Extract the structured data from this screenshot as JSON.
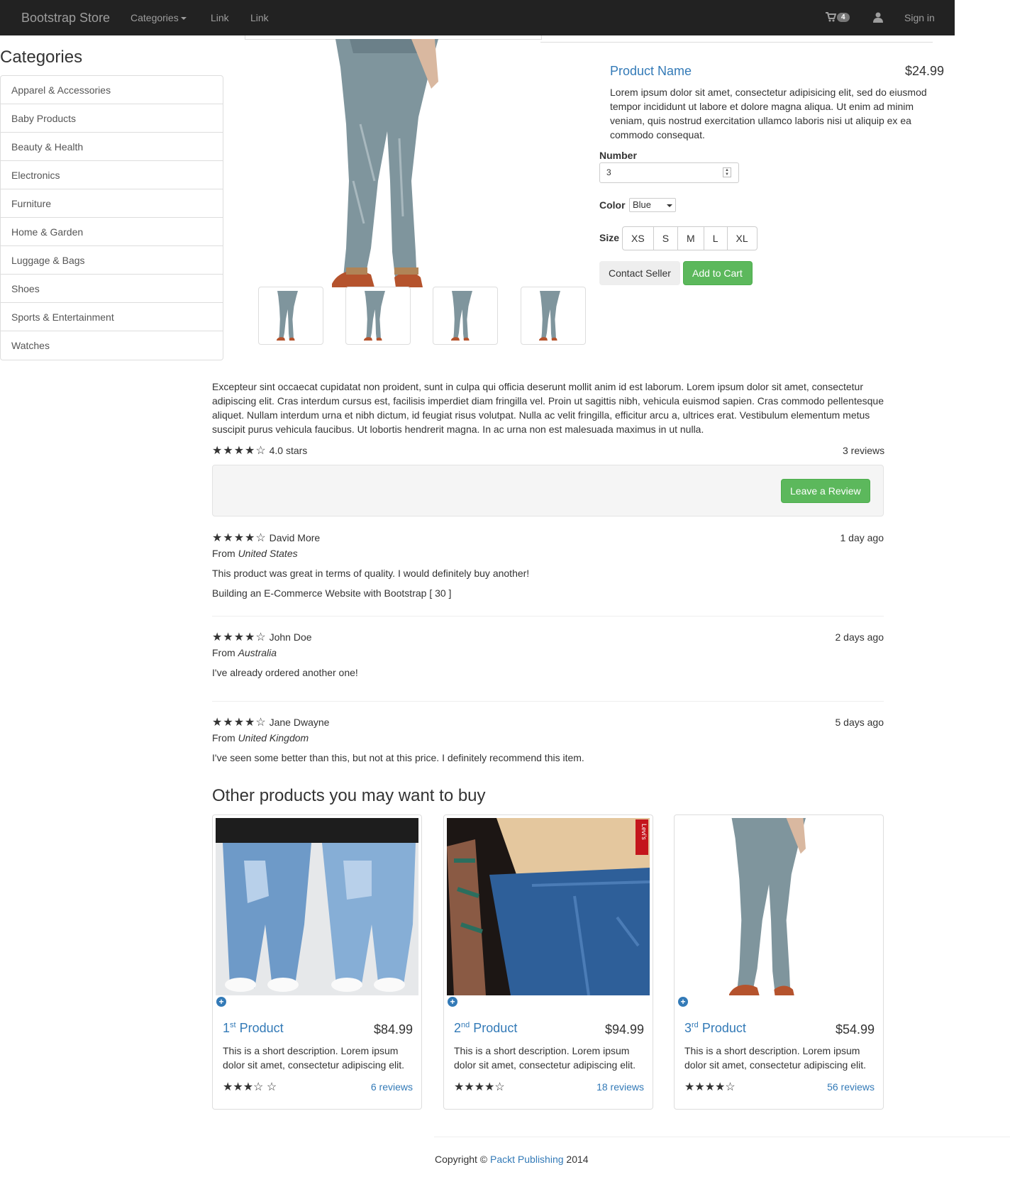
{
  "navbar": {
    "brand": "Bootstrap Store",
    "links": [
      "Categories",
      "Link",
      "Link"
    ],
    "cart_count": "4",
    "sign_in": "Sign in"
  },
  "sidebar": {
    "title": "Categories",
    "items": [
      "Apparel & Accessories",
      "Baby Products",
      "Beauty & Health",
      "Electronics",
      "Furniture",
      "Home & Garden",
      "Luggage & Bags",
      "Shoes",
      "Sports & Entertainment",
      "Watches"
    ]
  },
  "product": {
    "name": "Product Name",
    "price": "$24.99",
    "description": "Lorem ipsum dolor sit amet, consectetur adipisicing elit, sed do eiusmod tempor incididunt ut labore et dolore magna aliqua. Ut enim ad minim veniam, quis nostrud exercitation ullamco laboris nisi ut aliquip ex ea commodo consequat.",
    "number_label": "Number",
    "number_value": "3",
    "color_label": "Color",
    "color_value": "Blue",
    "size_label": "Size",
    "sizes": [
      "XS",
      "S",
      "M",
      "L",
      "XL"
    ],
    "contact_button": "Contact Seller",
    "add_button": "Add to Cart"
  },
  "details": {
    "long_description": "Excepteur sint occaecat cupidatat non proident, sunt in culpa qui officia deserunt mollit anim id est laborum. Lorem ipsum dolor sit amet, consectetur adipiscing elit. Cras interdum cursus est, facilisis imperdiet diam fringilla vel. Proin ut sagittis nibh, vehicula euismod sapien. Cras commodo pellentesque aliquet. Nullam interdum urna et nibh dictum, id feugiat risus volutpat. Nulla ac velit fringilla, efficitur arcu a, ultrices erat. Vestibulum elementum metus suscipit purus vehicula faucibus. Ut lobortis hendrerit magna. In ac urna non est malesuada maximus in ut nulla.",
    "stars": "★★★★☆",
    "rating_text": "4.0 stars",
    "review_count": "3 reviews",
    "leave_review": "Leave a Review"
  },
  "reviews": [
    {
      "stars": "★★★★☆",
      "name": "David More",
      "when": "1 day ago",
      "from_label": "From",
      "country": "United States",
      "text": "This product was great in terms of quality. I would definitely buy another!",
      "extra": "Building an E-Commerce Website with Bootstrap [ 30 ]"
    },
    {
      "stars": "★★★★☆",
      "name": "John Doe",
      "when": "2 days ago",
      "from_label": "From",
      "country": "Australia",
      "text": "I've already ordered another one!"
    },
    {
      "stars": "★★★★☆",
      "name": "Jane Dwayne",
      "when": "5 days ago",
      "from_label": "From",
      "country": "United Kingdom",
      "text": "I've seen some better than this, but not at this price. I definitely recommend this item."
    }
  ],
  "related": {
    "title": "Other products you may want to buy",
    "cards": [
      {
        "num": "1",
        "sup": "st",
        "label": "Product",
        "price": "$84.99",
        "desc": "This is a short description. Lorem ipsum dolor sit amet, consectetur adipiscing elit.",
        "stars": "★★★☆ ☆",
        "reviews": "6 reviews"
      },
      {
        "num": "2",
        "sup": "nd",
        "label": "Product",
        "price": "$94.99",
        "desc": "This is a short description. Lorem ipsum dolor sit amet, consectetur adipiscing elit.",
        "stars": "★★★★☆",
        "reviews": "18 reviews"
      },
      {
        "num": "3",
        "sup": "rd",
        "label": "Product",
        "price": "$54.99",
        "desc": "This is a short description. Lorem ipsum dolor sit amet, consectetur adipiscing elit.",
        "stars": "★★★★☆",
        "reviews": "56 reviews"
      }
    ],
    "badge_text": "Levi's"
  },
  "footer": {
    "prefix": "Copyright ©",
    "link": "Packt Publishing",
    "year": "2014"
  },
  "colors": {
    "navbar_bg": "#222222",
    "link": "#337ab7",
    "success": "#5cb85c"
  },
  "icons": {
    "cart": "shopping-cart-icon",
    "user": "user-icon",
    "plus": "plus-circle-icon"
  }
}
